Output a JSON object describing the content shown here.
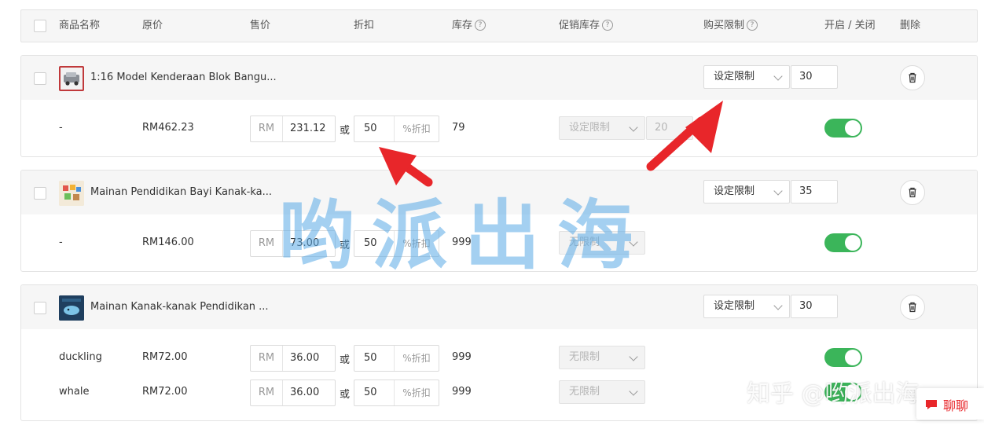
{
  "header": {
    "product_name": "商品名称",
    "original_price": "原价",
    "sale_price": "售价",
    "discount": "折扣",
    "stock": "库存",
    "promo_stock": "促销库存",
    "purchase_limit": "购买限制",
    "on_off": "开启 / 关闭",
    "delete": "删除",
    "help_glyph": "?"
  },
  "currency": "RM",
  "or_label": "或",
  "discount_suffix": "%折扣",
  "products": [
    {
      "name": "1:16 Model Kenderaan Blok Bangu...",
      "limit_select": "设定限制",
      "limit_value": "30",
      "variants": [
        {
          "name": "-",
          "original_price": "RM462.23",
          "price": "231.12",
          "discount": "50",
          "stock": "79",
          "promo_select": "设定限制",
          "promo_value": "20",
          "enabled": true
        }
      ]
    },
    {
      "name": "Mainan Pendidikan Bayi Kanak-ka...",
      "limit_select": "设定限制",
      "limit_value": "35",
      "variants": [
        {
          "name": "-",
          "original_price": "RM146.00",
          "price": "73.00",
          "discount": "50",
          "stock": "999",
          "promo_select": "无限制",
          "enabled": true
        }
      ]
    },
    {
      "name": "Mainan Kanak-kanak Pendidikan ...",
      "limit_select": "设定限制",
      "limit_value": "30",
      "variants": [
        {
          "name": "duckling",
          "original_price": "RM72.00",
          "price": "36.00",
          "discount": "50",
          "stock": "999",
          "promo_select": "无限制",
          "enabled": true
        },
        {
          "name": "whale",
          "original_price": "RM72.00",
          "price": "36.00",
          "discount": "50",
          "stock": "999",
          "promo_select": "无限制",
          "enabled": true
        }
      ]
    }
  ],
  "watermark": "哟派出海",
  "zhihu_watermark": "知乎 @哟派出海",
  "chat_button": "聊聊",
  "colors": {
    "toggle_on": "#3bb55a",
    "arrow": "#e8262a",
    "watermark": "#5aaae6",
    "chat": "#e8262a"
  }
}
